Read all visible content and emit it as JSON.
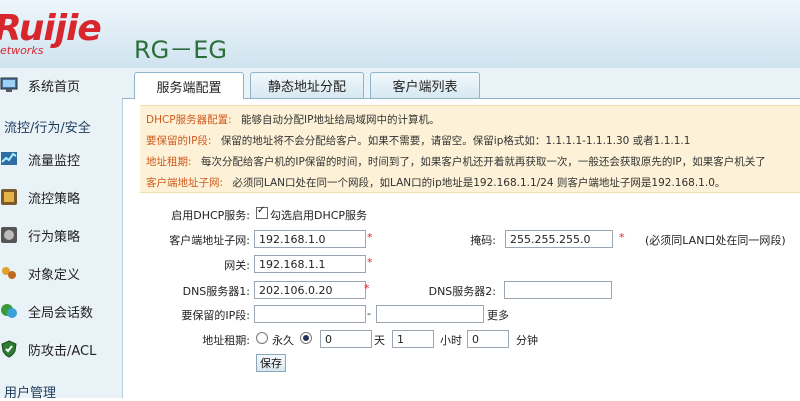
{
  "brand": {
    "logo": "Ruijie",
    "logo_sub": "etworks",
    "model": "RG－EG"
  },
  "sidebar": {
    "items": [
      {
        "label": "系统首页",
        "icon": "monitor-icon"
      },
      {
        "label": "流控/行为/安全",
        "icon": ""
      },
      {
        "label": "流量监控",
        "icon": "traffic-chart-icon"
      },
      {
        "label": "流控策略",
        "icon": "flow-control-icon"
      },
      {
        "label": "行为策略",
        "icon": "behavior-icon"
      },
      {
        "label": "对象定义",
        "icon": "objects-icon"
      },
      {
        "label": "全局会话数",
        "icon": "sessions-icon"
      },
      {
        "label": "防攻击/ACL",
        "icon": "shield-icon"
      },
      {
        "label": "用户管理",
        "icon": ""
      }
    ]
  },
  "tabs": [
    {
      "label": "服务端配置",
      "active": true
    },
    {
      "label": "静态地址分配",
      "active": false
    },
    {
      "label": "客户端列表",
      "active": false
    }
  ],
  "info": {
    "lines": [
      {
        "key": "DHCP服务器配置:",
        "text": "能够自动分配IP地址给局域网中的计算机。"
      },
      {
        "key": "要保留的IP段:",
        "text": "保留的地址将不会分配给客户。如果不需要，请留空。保留ip格式如：1.1.1.1-1.1.1.30 或者1.1.1.1"
      },
      {
        "key": "地址租期:",
        "text": "每次分配给客户机的IP保留的时间，时间到了，如果客户机还开着就再获取一次，一般还会获取原先的IP，如果客户机关了"
      },
      {
        "key": "客户端地址子网:",
        "text": "必须同LAN口处在同一个网段，如LAN口的ip地址是192.168.1.1/24 则客户端地址子网是192.168.1.0。"
      }
    ]
  },
  "form": {
    "enable_label": "启用DHCP服务:",
    "enable_checkbox_text": "勾选启用DHCP服务",
    "enable_checked": true,
    "subnet_label": "客户端地址子网:",
    "subnet_value": "192.168.1.0",
    "mask_label": "掩码:",
    "mask_value": "255.255.255.0",
    "mask_hint": "(必须同LAN口处在同一网段)",
    "gateway_label": "网关:",
    "gateway_value": "192.168.1.1",
    "dns1_label": "DNS服务器1:",
    "dns1_value": "202.106.0.20",
    "dns2_label": "DNS服务器2:",
    "dns2_value": "",
    "reserved_label": "要保留的IP段:",
    "reserved_start": "",
    "reserved_sep": "-",
    "reserved_end": "",
    "reserved_more": "更多",
    "lease_label": "地址租期:",
    "lease_permanent": "永久",
    "lease_days": "0",
    "lease_days_unit": "天",
    "lease_hours": "1",
    "lease_hours_unit": "小时",
    "lease_minutes": "0",
    "lease_minutes_unit": "分钟",
    "required_mark": "*",
    "save_label": "保存"
  },
  "colors": {
    "brand_red": "#d8262d",
    "model_green": "#2a6f3a",
    "info_key": "#d05a1c",
    "info_bg": "#fdf2d8"
  }
}
